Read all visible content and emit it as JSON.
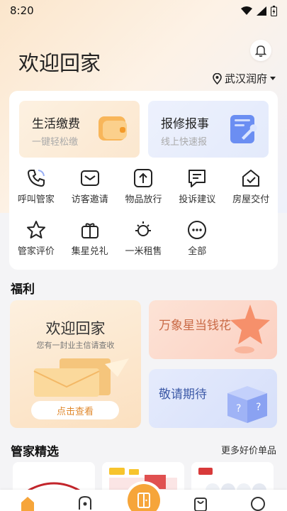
{
  "status_bar": {
    "time": "8:20"
  },
  "header": {
    "welcome": "欢迎回家",
    "location": "武汉润府"
  },
  "services": [
    {
      "title": "生活缴费",
      "subtitle": "一键轻松缴"
    },
    {
      "title": "报修报事",
      "subtitle": "线上快速报"
    }
  ],
  "grid": [
    {
      "label": "呼叫管家",
      "icon": "phone-icon"
    },
    {
      "label": "访客邀请",
      "icon": "mail-icon"
    },
    {
      "label": "物品放行",
      "icon": "upload-box-icon"
    },
    {
      "label": "投诉建议",
      "icon": "chat-icon"
    },
    {
      "label": "房屋交付",
      "icon": "house-check-icon"
    },
    {
      "label": "管家评价",
      "icon": "star-icon"
    },
    {
      "label": "集星兑礼",
      "icon": "gift-icon"
    },
    {
      "label": "一米租售",
      "icon": "sun-icon"
    },
    {
      "label": "全部",
      "icon": "more-icon"
    }
  ],
  "benefits": {
    "title": "福利",
    "big": {
      "title": "欢迎回家",
      "subtitle": "您有一封业主信请查收",
      "button": "点击查看"
    },
    "small": [
      {
        "title": "万象星当钱花"
      },
      {
        "title": "敬请期待"
      }
    ]
  },
  "picks": {
    "title": "管家精选",
    "more": "更多好价单品"
  },
  "colors": {
    "accent": "#f6a53a",
    "tile_pay": "#fbe7cf",
    "tile_repair": "#e3eafb"
  }
}
